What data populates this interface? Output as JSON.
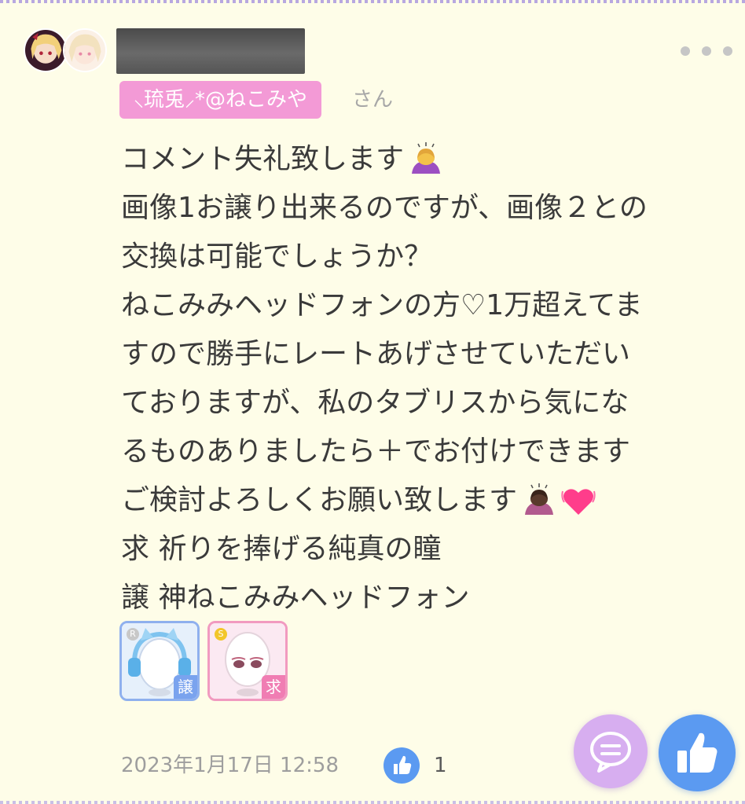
{
  "comment": {
    "mention": "⸜琉兎⸝*@ねこみや",
    "honorific": "さん",
    "lines": [
      "コメント失礼致します",
      "画像1お譲り出来るのですが、画像２との",
      "交換は可能でしょうか？",
      "ねこみみヘッドフォンの方♡1万超えてま",
      "すので勝手にレートあげさせていただい",
      "ておりますが、私のタブリスから気にな",
      "るものありましたら＋でお付けできます",
      "ご検討よろしくお願い致します",
      "求 祈りを捧げる純真の瞳",
      "譲 神ねこみみヘッドフォン"
    ],
    "emojis": [
      "person-bowing-emoji",
      "person-bowing-emoji",
      "growing-heart-emoji"
    ],
    "items": [
      {
        "rarity": "R",
        "tag": "譲",
        "icon": "cat-ear-headphones-item",
        "color": "#8fb0ee"
      },
      {
        "rarity": "S",
        "tag": "求",
        "icon": "pure-eyes-item",
        "color": "#f19ac0"
      }
    ],
    "timestamp": "2023年1月17日 12:58",
    "like_count": "1"
  },
  "colors": {
    "background": "#fefde8",
    "mention_bg": "#f39ad6",
    "comment_fab": "#d7aef0",
    "like_fab": "#5b9af1"
  }
}
